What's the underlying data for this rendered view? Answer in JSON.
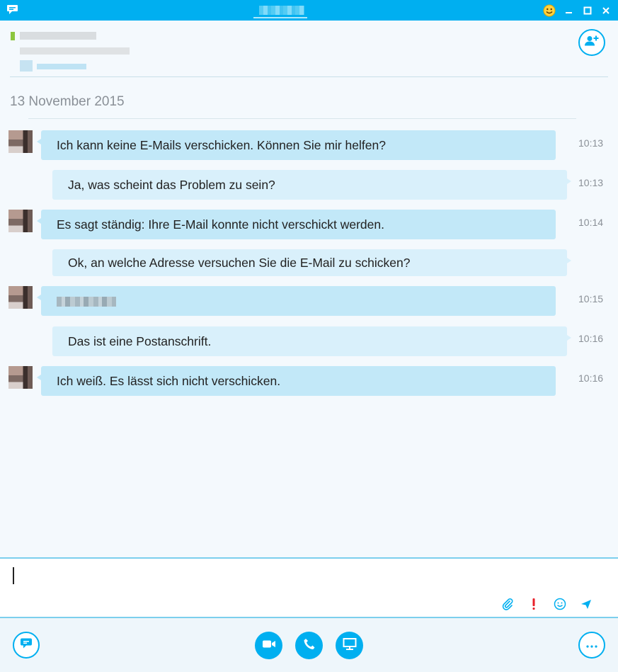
{
  "window": {
    "title": "",
    "icons": {
      "app": "skype-chat-icon",
      "status": "smiley-icon",
      "minimize": "minimize-icon",
      "maximize": "maximize-icon",
      "close": "close-icon"
    }
  },
  "header": {
    "contact_name": "",
    "mood_message": "",
    "location": "",
    "add_contact_icon": "add-contact-icon"
  },
  "conversation": {
    "date": "13 November 2015",
    "messages": [
      {
        "direction": "incoming",
        "text": "Ich kann keine E-Mails verschicken. Können Sie mir helfen?",
        "time": "10:13"
      },
      {
        "direction": "outgoing",
        "text": "Ja, was scheint das Problem zu sein?",
        "time": "10:13"
      },
      {
        "direction": "incoming",
        "text": "Es sagt ständig: Ihre E-Mail konnte nicht verschickt werden.",
        "time": "10:14"
      },
      {
        "direction": "outgoing",
        "text": "Ok, an welche Adresse versuchen Sie die E-Mail zu schicken?",
        "time": ""
      },
      {
        "direction": "incoming",
        "text": "",
        "time": "10:15"
      },
      {
        "direction": "outgoing",
        "text": "Das ist eine Postanschrift.",
        "time": "10:16"
      },
      {
        "direction": "incoming",
        "text": "Ich weiß. Es lässt sich nicht verschicken.",
        "time": "10:16"
      }
    ]
  },
  "composer": {
    "value": "",
    "placeholder": "",
    "tools": [
      "attach-file-icon",
      "high-importance-icon",
      "emoticon-icon",
      "send-icon"
    ]
  },
  "bottom_bar": {
    "left": "chat-icon",
    "center": [
      "video-call-icon",
      "voice-call-icon",
      "screen-share-icon"
    ],
    "right": "more-options-icon"
  },
  "colors": {
    "accent": "#00aff0",
    "incoming_bubble": "#c2e8f8",
    "outgoing_bubble": "#d9f0fb",
    "status_online": "#8cc63f",
    "importance": "#e8202a"
  }
}
